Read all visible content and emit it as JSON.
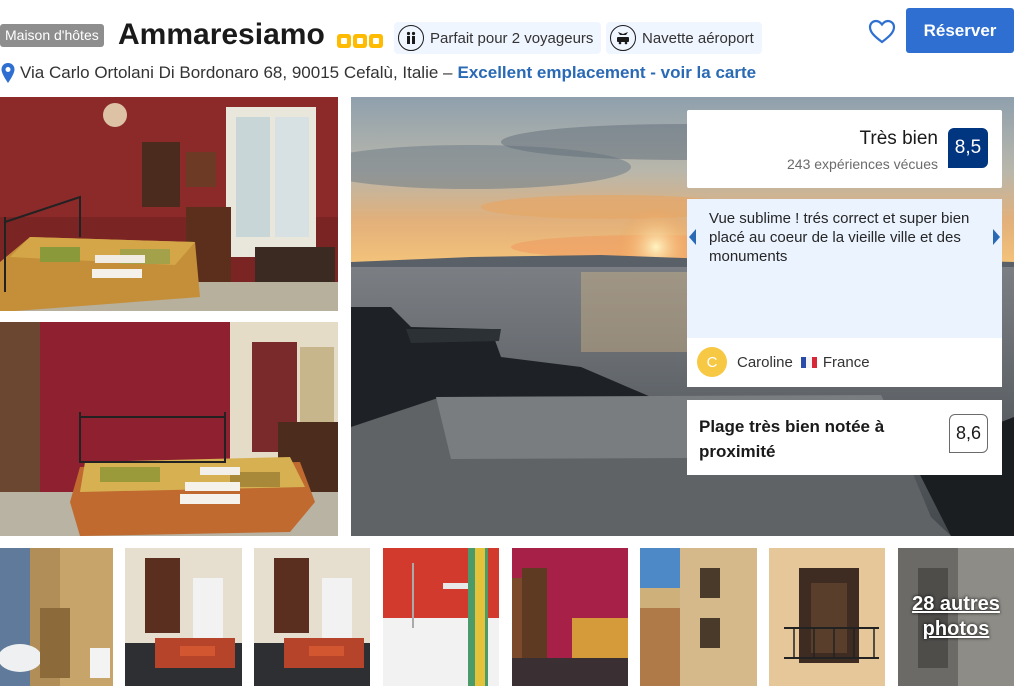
{
  "header": {
    "property_type": "Maison d'hôtes",
    "name": "Ammaresiamo",
    "star_rating": 3,
    "highlights": [
      {
        "icon": "couple-icon",
        "label": "Parfait pour 2 voyageurs"
      },
      {
        "icon": "shuttle-icon",
        "label": "Navette aéroport"
      }
    ],
    "reserve_label": "Réserver",
    "address": "Via Carlo Ortolani Di Bordonaro 68, 90015 Cefalù, Italie –",
    "map_link": "Excellent emplacement - voir la carte"
  },
  "rating": {
    "label": "Très bien",
    "count": "243 expériences vécues",
    "score": "8,5"
  },
  "review": {
    "text": "Vue sublime ! trés correct et super bien placé au coeur de la vieille ville et des monuments",
    "reviewer_initial": "C",
    "reviewer_name": "Caroline",
    "reviewer_country": "France"
  },
  "beach": {
    "label": "Plage très bien notée à proximité",
    "score": "8,6"
  },
  "gallery": {
    "more_count": "28 autres",
    "more_label": "photos"
  },
  "colors": {
    "accent": "#2e6fd1",
    "score_bg": "#003580",
    "star": "#febb02",
    "link": "#2a6ab5"
  }
}
